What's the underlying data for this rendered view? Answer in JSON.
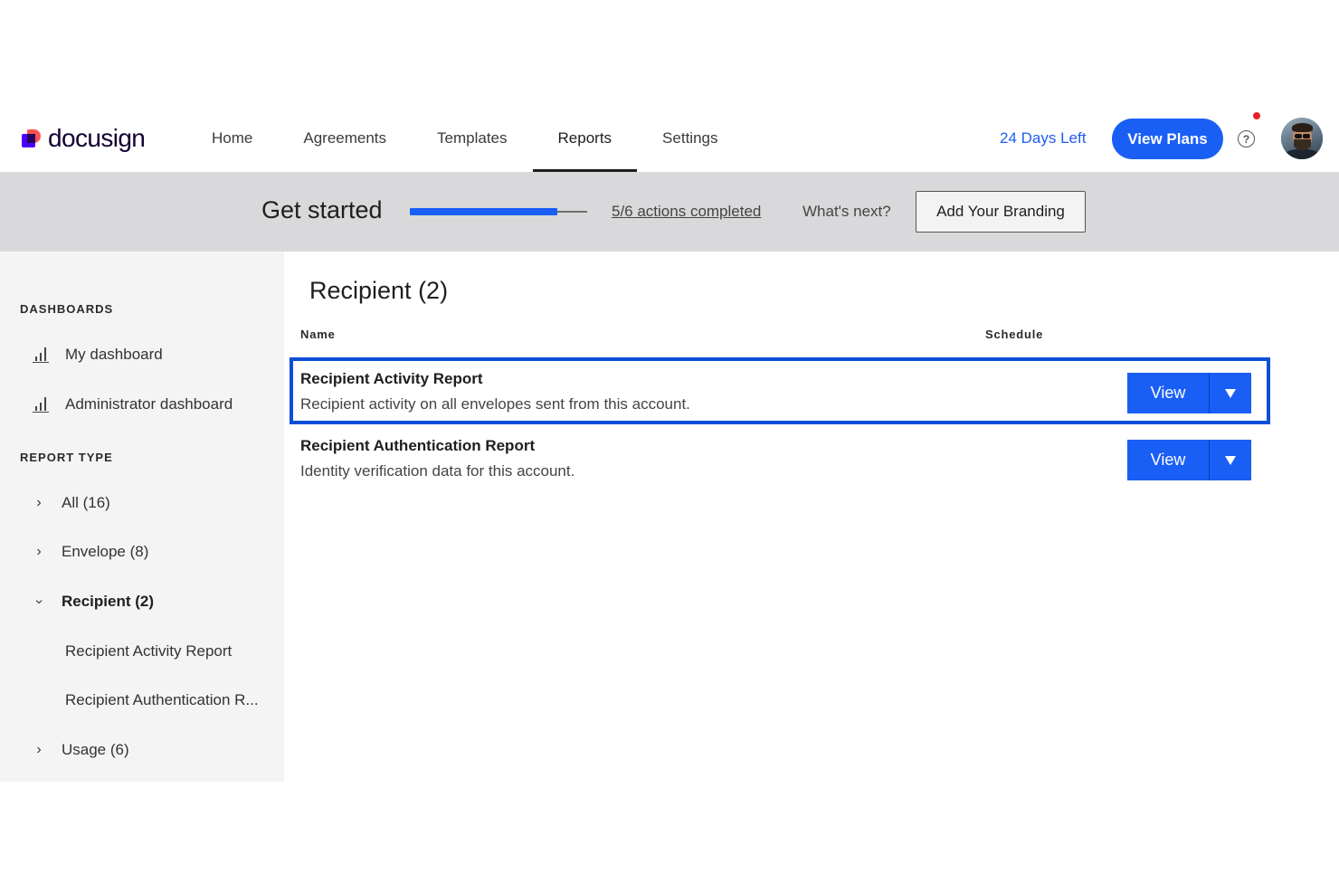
{
  "header": {
    "logo_text": "docusign",
    "nav": [
      {
        "label": "Home"
      },
      {
        "label": "Agreements"
      },
      {
        "label": "Templates"
      },
      {
        "label": "Reports",
        "active": true
      },
      {
        "label": "Settings"
      }
    ],
    "days_left": "24 Days Left",
    "view_plans": "View Plans",
    "help_icon": "?",
    "brand_color": "#1a5ff5"
  },
  "banner": {
    "title": "Get started",
    "progress_fraction": 0.833,
    "actions_link": "5/6 actions completed",
    "whats_next": "What's next?",
    "branding_button": "Add Your Branding"
  },
  "sidebar": {
    "dashboards_heading": "DASHBOARDS",
    "dashboards": [
      {
        "label": "My dashboard",
        "icon": "bar-chart-icon"
      },
      {
        "label": "Administrator dashboard",
        "icon": "bar-chart-icon"
      }
    ],
    "report_type_heading": "REPORT TYPE",
    "types": [
      {
        "label": "All (16)",
        "expanded": false
      },
      {
        "label": "Envelope (8)",
        "expanded": false
      },
      {
        "label": "Recipient (2)",
        "expanded": true
      },
      {
        "label": "Usage (6)",
        "expanded": false
      }
    ],
    "sub_items": [
      {
        "label": "Recipient Activity Report"
      },
      {
        "label": "Recipient Authentication R..."
      }
    ]
  },
  "main": {
    "title": "Recipient (2)",
    "columns": {
      "name": "Name",
      "schedule": "Schedule"
    },
    "rows": [
      {
        "title": "Recipient Activity Report",
        "description": "Recipient activity on all envelopes sent from this account.",
        "button": "View",
        "highlighted": true
      },
      {
        "title": "Recipient Authentication Report",
        "description": "Identity verification data for this account.",
        "button": "View",
        "highlighted": false
      }
    ]
  }
}
